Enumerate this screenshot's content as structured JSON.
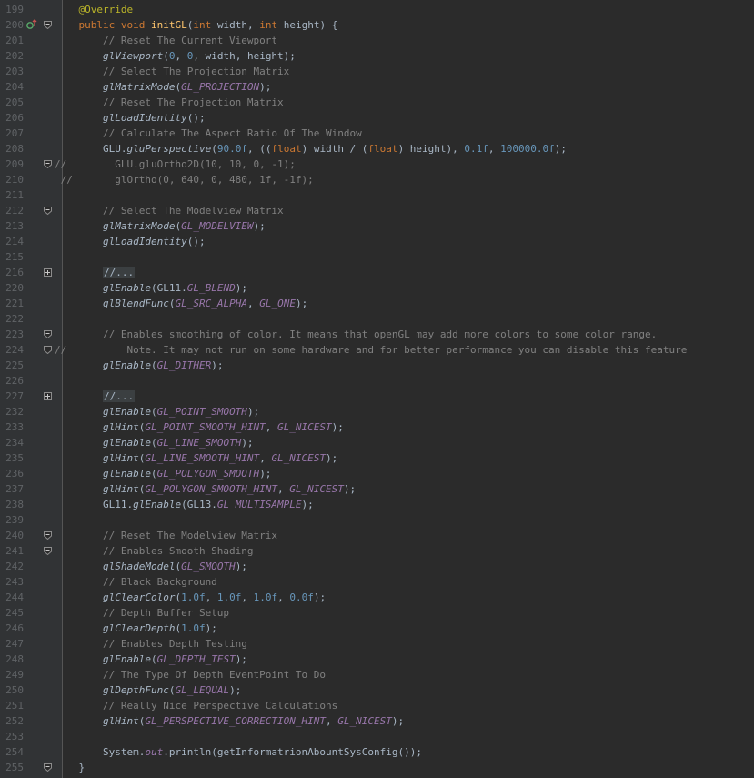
{
  "colors": {
    "background": "#2b2b2b",
    "gutter": "#313335",
    "keyword": "#cc7832",
    "method": "#ffc66d",
    "number": "#6897bb",
    "comment": "#808080",
    "annotation": "#bbb529",
    "constant": "#9876aa",
    "text": "#a9b7c6"
  },
  "lines": [
    {
      "n": "199",
      "fold": "",
      "segs": [
        [
          "ann",
          "    @Override"
        ]
      ]
    },
    {
      "n": "200",
      "fold": "minus",
      "marker": true,
      "segs": [
        [
          "kw",
          "    public void "
        ],
        [
          "fn",
          "initGL"
        ],
        [
          "t",
          "("
        ],
        [
          "kw",
          "int "
        ],
        [
          "t",
          "width, "
        ],
        [
          "kw",
          "int "
        ],
        [
          "t",
          "height) {"
        ]
      ]
    },
    {
      "n": "201",
      "fold": "",
      "segs": [
        [
          "cm",
          "        // Reset The Current Viewport"
        ]
      ]
    },
    {
      "n": "202",
      "fold": "",
      "segs": [
        [
          "it",
          "        glViewport"
        ],
        [
          "t",
          "("
        ],
        [
          "num",
          "0"
        ],
        [
          "t",
          ", "
        ],
        [
          "num",
          "0"
        ],
        [
          "t",
          ", width, height);"
        ]
      ]
    },
    {
      "n": "203",
      "fold": "",
      "segs": [
        [
          "cm",
          "        // Select The Projection Matrix"
        ]
      ]
    },
    {
      "n": "204",
      "fold": "",
      "segs": [
        [
          "it",
          "        glMatrixMode"
        ],
        [
          "t",
          "("
        ],
        [
          "const",
          "GL_PROJECTION"
        ],
        [
          "t",
          ");"
        ]
      ]
    },
    {
      "n": "205",
      "fold": "",
      "segs": [
        [
          "cm",
          "        // Reset The Projection Matrix"
        ]
      ]
    },
    {
      "n": "206",
      "fold": "",
      "segs": [
        [
          "it",
          "        glLoadIdentity"
        ],
        [
          "t",
          "();"
        ]
      ]
    },
    {
      "n": "207",
      "fold": "",
      "segs": [
        [
          "cm",
          "        // Calculate The Aspect Ratio Of The Window"
        ]
      ]
    },
    {
      "n": "208",
      "fold": "",
      "segs": [
        [
          "t",
          "        GLU."
        ],
        [
          "it",
          "gluPerspective"
        ],
        [
          "t",
          "("
        ],
        [
          "num",
          "90.0f"
        ],
        [
          "t",
          ", (("
        ],
        [
          "kw",
          "float"
        ],
        [
          "t",
          ") width / ("
        ],
        [
          "kw",
          "float"
        ],
        [
          "t",
          ") height), "
        ],
        [
          "num",
          "0.1f"
        ],
        [
          "t",
          ", "
        ],
        [
          "num",
          "100000.0f"
        ],
        [
          "t",
          ");"
        ]
      ]
    },
    {
      "n": "209",
      "fold": "minus",
      "segs": [
        [
          "cm",
          "//        GLU.gluOrtho2D(10, 10, 0, -1);"
        ]
      ]
    },
    {
      "n": "210",
      "fold": "",
      "segs": [
        [
          "cm",
          " //       glOrtho(0, 640, 0, 480, 1f, -1f);"
        ]
      ]
    },
    {
      "n": "211",
      "fold": "",
      "segs": [
        [
          "t",
          ""
        ]
      ]
    },
    {
      "n": "212",
      "fold": "minus",
      "segs": [
        [
          "cm",
          "        // Select The Modelview Matrix"
        ]
      ]
    },
    {
      "n": "213",
      "fold": "",
      "segs": [
        [
          "it",
          "        glMatrixMode"
        ],
        [
          "t",
          "("
        ],
        [
          "const",
          "GL_MODELVIEW"
        ],
        [
          "t",
          ");"
        ]
      ]
    },
    {
      "n": "214",
      "fold": "",
      "segs": [
        [
          "it",
          "        glLoadIdentity"
        ],
        [
          "t",
          "();"
        ]
      ]
    },
    {
      "n": "215",
      "fold": "",
      "segs": [
        [
          "t",
          ""
        ]
      ]
    },
    {
      "n": "216",
      "fold": "plus",
      "segs": [
        [
          "t",
          "        "
        ],
        [
          "fold",
          "//..."
        ]
      ]
    },
    {
      "n": "220",
      "fold": "",
      "segs": [
        [
          "it",
          "        glEnable"
        ],
        [
          "t",
          "(GL11."
        ],
        [
          "const",
          "GL_BLEND"
        ],
        [
          "t",
          ");"
        ]
      ]
    },
    {
      "n": "221",
      "fold": "",
      "segs": [
        [
          "it",
          "        glBlendFunc"
        ],
        [
          "t",
          "("
        ],
        [
          "const",
          "GL_SRC_ALPHA"
        ],
        [
          "t",
          ", "
        ],
        [
          "const",
          "GL_ONE"
        ],
        [
          "t",
          ");"
        ]
      ]
    },
    {
      "n": "222",
      "fold": "",
      "segs": [
        [
          "t",
          ""
        ]
      ]
    },
    {
      "n": "223",
      "fold": "minus",
      "segs": [
        [
          "cm",
          "        // Enables smoothing of color. It means that openGL may add more colors to some color range."
        ]
      ]
    },
    {
      "n": "224",
      "fold": "minus",
      "segs": [
        [
          "cm",
          "//          Note. It may not run on some hardware and for better performance you can disable this feature"
        ]
      ]
    },
    {
      "n": "225",
      "fold": "",
      "segs": [
        [
          "it",
          "        glEnable"
        ],
        [
          "t",
          "("
        ],
        [
          "const",
          "GL_DITHER"
        ],
        [
          "t",
          ");"
        ]
      ]
    },
    {
      "n": "226",
      "fold": "",
      "segs": [
        [
          "t",
          ""
        ]
      ]
    },
    {
      "n": "227",
      "fold": "plus",
      "segs": [
        [
          "t",
          "        "
        ],
        [
          "fold",
          "//..."
        ]
      ]
    },
    {
      "n": "232",
      "fold": "",
      "segs": [
        [
          "it",
          "        glEnable"
        ],
        [
          "t",
          "("
        ],
        [
          "const",
          "GL_POINT_SMOOTH"
        ],
        [
          "t",
          ");"
        ]
      ]
    },
    {
      "n": "233",
      "fold": "",
      "segs": [
        [
          "it",
          "        glHint"
        ],
        [
          "t",
          "("
        ],
        [
          "const",
          "GL_POINT_SMOOTH_HINT"
        ],
        [
          "t",
          ", "
        ],
        [
          "const",
          "GL_NICEST"
        ],
        [
          "t",
          ");"
        ]
      ]
    },
    {
      "n": "234",
      "fold": "",
      "segs": [
        [
          "it",
          "        glEnable"
        ],
        [
          "t",
          "("
        ],
        [
          "const",
          "GL_LINE_SMOOTH"
        ],
        [
          "t",
          ");"
        ]
      ]
    },
    {
      "n": "235",
      "fold": "",
      "segs": [
        [
          "it",
          "        glHint"
        ],
        [
          "t",
          "("
        ],
        [
          "const",
          "GL_LINE_SMOOTH_HINT"
        ],
        [
          "t",
          ", "
        ],
        [
          "const",
          "GL_NICEST"
        ],
        [
          "t",
          ");"
        ]
      ]
    },
    {
      "n": "236",
      "fold": "",
      "segs": [
        [
          "it",
          "        glEnable"
        ],
        [
          "t",
          "("
        ],
        [
          "const",
          "GL_POLYGON_SMOOTH"
        ],
        [
          "t",
          ");"
        ]
      ]
    },
    {
      "n": "237",
      "fold": "",
      "segs": [
        [
          "it",
          "        glHint"
        ],
        [
          "t",
          "("
        ],
        [
          "const",
          "GL_POLYGON_SMOOTH_HINT"
        ],
        [
          "t",
          ", "
        ],
        [
          "const",
          "GL_NICEST"
        ],
        [
          "t",
          ");"
        ]
      ]
    },
    {
      "n": "238",
      "fold": "",
      "segs": [
        [
          "t",
          "        GL11."
        ],
        [
          "it",
          "glEnable"
        ],
        [
          "t",
          "(GL13."
        ],
        [
          "const",
          "GL_MULTISAMPLE"
        ],
        [
          "t",
          ");"
        ]
      ]
    },
    {
      "n": "239",
      "fold": "",
      "segs": [
        [
          "t",
          ""
        ]
      ]
    },
    {
      "n": "240",
      "fold": "minus",
      "segs": [
        [
          "cm",
          "        // Reset The Modelview Matrix"
        ]
      ]
    },
    {
      "n": "241",
      "fold": "minus",
      "segs": [
        [
          "cm",
          "        // Enables Smooth Shading"
        ]
      ]
    },
    {
      "n": "242",
      "fold": "",
      "segs": [
        [
          "it",
          "        glShadeModel"
        ],
        [
          "t",
          "("
        ],
        [
          "const",
          "GL_SMOOTH"
        ],
        [
          "t",
          ");"
        ]
      ]
    },
    {
      "n": "243",
      "fold": "",
      "segs": [
        [
          "cm",
          "        // Black Background"
        ]
      ]
    },
    {
      "n": "244",
      "fold": "",
      "segs": [
        [
          "it",
          "        glClearColor"
        ],
        [
          "t",
          "("
        ],
        [
          "num",
          "1.0f"
        ],
        [
          "t",
          ", "
        ],
        [
          "num",
          "1.0f"
        ],
        [
          "t",
          ", "
        ],
        [
          "num",
          "1.0f"
        ],
        [
          "t",
          ", "
        ],
        [
          "num",
          "0.0f"
        ],
        [
          "t",
          ");"
        ]
      ]
    },
    {
      "n": "245",
      "fold": "",
      "segs": [
        [
          "cm",
          "        // Depth Buffer Setup"
        ]
      ]
    },
    {
      "n": "246",
      "fold": "",
      "segs": [
        [
          "it",
          "        glClearDepth"
        ],
        [
          "t",
          "("
        ],
        [
          "num",
          "1.0f"
        ],
        [
          "t",
          ");"
        ]
      ]
    },
    {
      "n": "247",
      "fold": "",
      "segs": [
        [
          "cm",
          "        // Enables Depth Testing"
        ]
      ]
    },
    {
      "n": "248",
      "fold": "",
      "segs": [
        [
          "it",
          "        glEnable"
        ],
        [
          "t",
          "("
        ],
        [
          "const",
          "GL_DEPTH_TEST"
        ],
        [
          "t",
          ");"
        ]
      ]
    },
    {
      "n": "249",
      "fold": "",
      "segs": [
        [
          "cm",
          "        // The Type Of Depth EventPoint To Do"
        ]
      ]
    },
    {
      "n": "250",
      "fold": "",
      "segs": [
        [
          "it",
          "        glDepthFunc"
        ],
        [
          "t",
          "("
        ],
        [
          "const",
          "GL_LEQUAL"
        ],
        [
          "t",
          ");"
        ]
      ]
    },
    {
      "n": "251",
      "fold": "",
      "segs": [
        [
          "cm",
          "        // Really Nice Perspective Calculations"
        ]
      ]
    },
    {
      "n": "252",
      "fold": "",
      "segs": [
        [
          "it",
          "        glHint"
        ],
        [
          "t",
          "("
        ],
        [
          "const",
          "GL_PERSPECTIVE_CORRECTION_HINT"
        ],
        [
          "t",
          ", "
        ],
        [
          "const",
          "GL_NICEST"
        ],
        [
          "t",
          ");"
        ]
      ]
    },
    {
      "n": "253",
      "fold": "",
      "segs": [
        [
          "t",
          ""
        ]
      ]
    },
    {
      "n": "254",
      "fold": "",
      "segs": [
        [
          "t",
          "        System."
        ],
        [
          "field",
          "out"
        ],
        [
          "t",
          ".println(getInformatrionAbountSysConfig());"
        ]
      ]
    },
    {
      "n": "255",
      "fold": "minus",
      "segs": [
        [
          "t",
          "    }"
        ]
      ]
    }
  ]
}
